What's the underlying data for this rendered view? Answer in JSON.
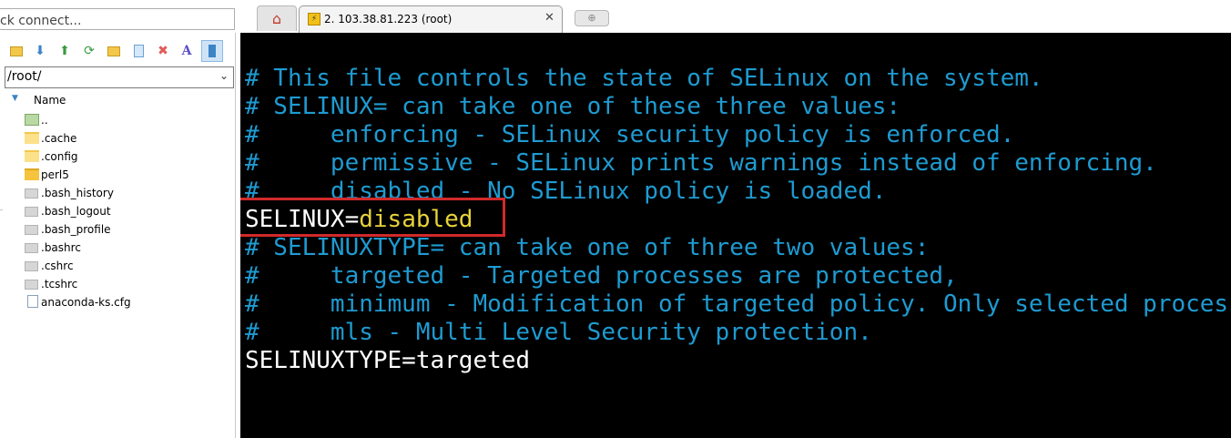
{
  "quick_connect": {
    "value": "ck connect..."
  },
  "toolbar": {
    "icons": [
      "folder-up-icon",
      "download-icon",
      "upload-icon",
      "refresh-icon",
      "new-folder-icon",
      "new-file-icon",
      "delete-icon",
      "rename-icon",
      "panel-toggle-icon"
    ]
  },
  "path": {
    "value": "/root/"
  },
  "file_list": {
    "header_name": "Name",
    "items": [
      {
        "name": "..",
        "kind": "parent"
      },
      {
        "name": ".cache",
        "kind": "folder"
      },
      {
        "name": ".config",
        "kind": "folder"
      },
      {
        "name": "perl5",
        "kind": "folder"
      },
      {
        "name": ".bash_history",
        "kind": "file"
      },
      {
        "name": ".bash_logout",
        "kind": "file"
      },
      {
        "name": ".bash_profile",
        "kind": "file"
      },
      {
        "name": ".bashrc",
        "kind": "file"
      },
      {
        "name": ".cshrc",
        "kind": "file"
      },
      {
        "name": ".tcshrc",
        "kind": "file"
      },
      {
        "name": "anaconda-ks.cfg",
        "kind": "config"
      }
    ]
  },
  "tabs": {
    "session_title": "2. 103.38.81.223 (root)",
    "close_glyph": "✕",
    "new_tab_glyph": "⊕"
  },
  "terminal": {
    "lines": [
      "# This file controls the state of SELinux on the system.",
      "# SELINUX= can take one of these three values:",
      "#     enforcing - SELinux security policy is enforced.",
      "#     permissive - SELinux prints warnings instead of enforcing.",
      "#     disabled - No SELinux policy is loaded.",
      "",
      "# SELINUXTYPE= can take one of three two values:",
      "#     targeted - Targeted processes are protected,",
      "#     minimum - Modification of targeted policy. Only selected processes are protected.",
      "#     mls - Multi Level Security protection.",
      "SELINUXTYPE=targeted"
    ],
    "selinux_key": "SELINUX=",
    "selinux_value": "disabled"
  },
  "colors": {
    "comment": "#1e9bd1",
    "value": "#e7d23a",
    "highlight": "#d12a2a"
  }
}
